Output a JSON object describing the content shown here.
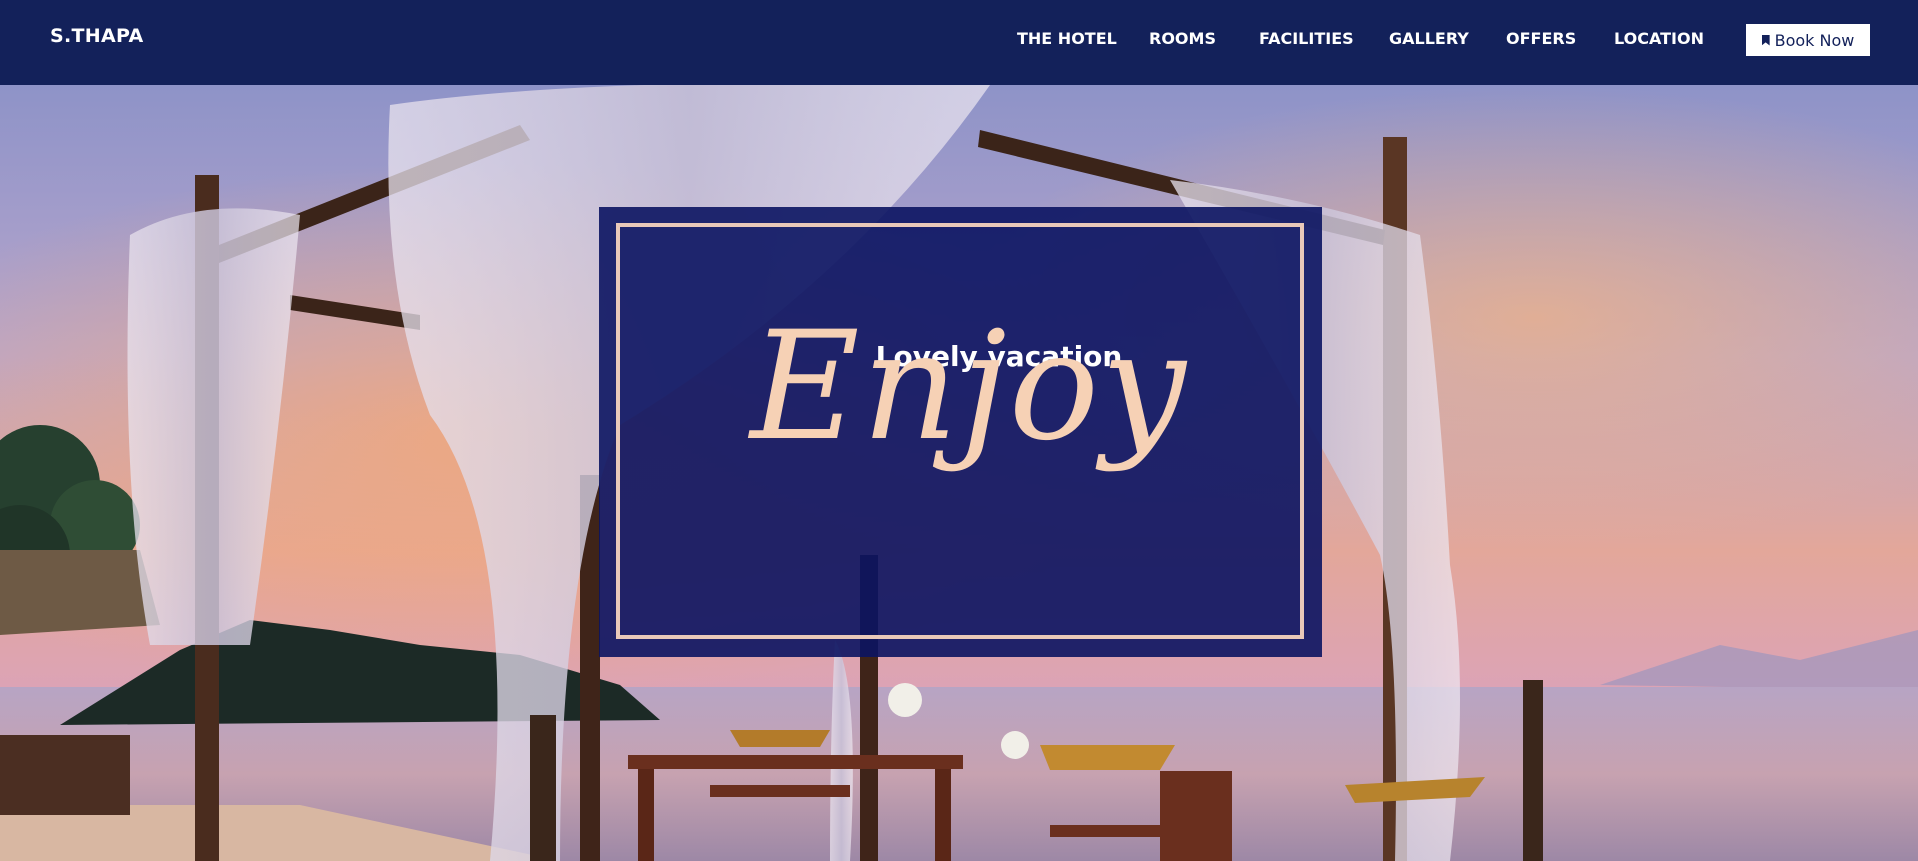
{
  "header": {
    "brand": "S.THAPA",
    "nav": [
      "THE HOTEL",
      "ROOMS",
      "FACILITIES",
      "GALLERY",
      "OFFERS",
      "LOCATION"
    ],
    "book_label": "Book Now"
  },
  "hero": {
    "tagline": "Lovely vacation",
    "headline": "Enjoy"
  },
  "colors": {
    "navy": "#13215a",
    "overlay": "#0b1462",
    "accent": "#f6d1b5",
    "white": "#ffffff"
  },
  "icons": {
    "book": "bookmark-icon"
  }
}
